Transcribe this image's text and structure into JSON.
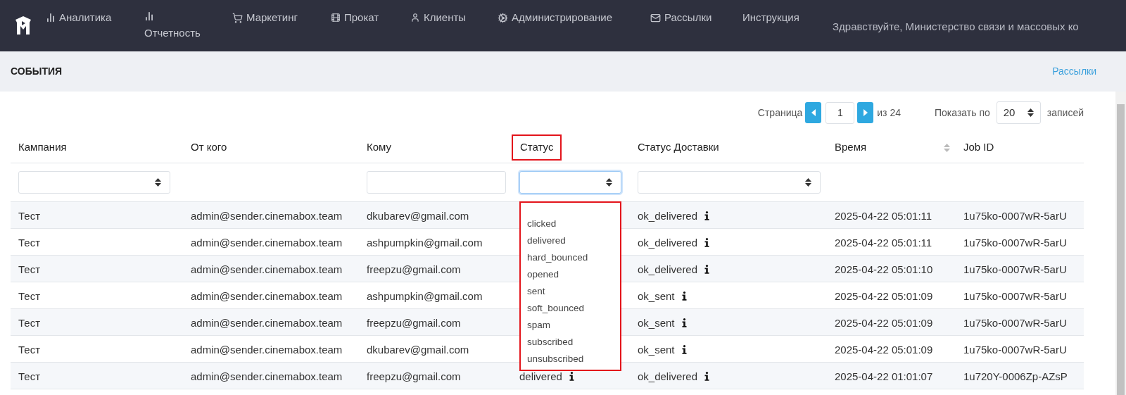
{
  "nav": {
    "items": [
      {
        "label": "Аналитика"
      },
      {
        "label": "Отчетность"
      },
      {
        "label": "Маркетинг"
      },
      {
        "label": "Прокат"
      },
      {
        "label": "Клиенты"
      },
      {
        "label": "Администрирование"
      },
      {
        "label": "Рассылки"
      },
      {
        "label": "Инструкция"
      }
    ],
    "greeting": "Здравствуйте, Министерство связи и массовых ко"
  },
  "page": {
    "title": "СОБЫТИЯ",
    "link": "Рассылки"
  },
  "pagination": {
    "page_label": "Страница",
    "page": "1",
    "of": "из 24",
    "show_label": "Показать по",
    "per_page": "20",
    "records_label": "записей"
  },
  "table": {
    "columns": [
      {
        "label": "Кампания",
        "highlighted": false,
        "sortable": false
      },
      {
        "label": "От кого",
        "highlighted": false,
        "sortable": false
      },
      {
        "label": "Кому",
        "highlighted": false,
        "sortable": false
      },
      {
        "label": "Статус",
        "highlighted": true,
        "sortable": false
      },
      {
        "label": "Статус Доставки",
        "highlighted": false,
        "sortable": false
      },
      {
        "label": "Время",
        "highlighted": false,
        "sortable": true
      },
      {
        "label": "Job ID",
        "highlighted": false,
        "sortable": false
      }
    ],
    "filters": [
      {
        "kind": "select",
        "focused": false
      },
      {
        "kind": "blank"
      },
      {
        "kind": "input",
        "focused": false
      },
      {
        "kind": "select",
        "focused": true
      },
      {
        "kind": "select",
        "focused": false
      },
      {
        "kind": "blank"
      },
      {
        "kind": "blank"
      }
    ],
    "status_dropdown": {
      "options": [
        "clicked",
        "delivered",
        "hard_bounced",
        "opened",
        "sent",
        "soft_bounced",
        "spam",
        "subscribed",
        "unsubscribed"
      ]
    },
    "rows": [
      {
        "campaign": "Тест",
        "from": "admin@sender.cinemabox.team",
        "to": "dkubarev@gmail.com",
        "delivery": "ok_delivered",
        "time": "2025-04-22 05:01:11",
        "job_id": "1u75ko-0007wR-5arU"
      },
      {
        "campaign": "Тест",
        "from": "admin@sender.cinemabox.team",
        "to": "ashpumpkin@gmail.com",
        "delivery": "ok_delivered",
        "time": "2025-04-22 05:01:11",
        "job_id": "1u75ko-0007wR-5arU"
      },
      {
        "campaign": "Тест",
        "from": "admin@sender.cinemabox.team",
        "to": "freepzu@gmail.com",
        "delivery": "ok_delivered",
        "time": "2025-04-22 05:01:10",
        "job_id": "1u75ko-0007wR-5arU"
      },
      {
        "campaign": "Тест",
        "from": "admin@sender.cinemabox.team",
        "to": "ashpumpkin@gmail.com",
        "delivery": "ok_sent",
        "time": "2025-04-22 05:01:09",
        "job_id": "1u75ko-0007wR-5arU"
      },
      {
        "campaign": "Тест",
        "from": "admin@sender.cinemabox.team",
        "to": "freepzu@gmail.com",
        "delivery": "ok_sent",
        "time": "2025-04-22 05:01:09",
        "job_id": "1u75ko-0007wR-5arU"
      },
      {
        "campaign": "Тест",
        "from": "admin@sender.cinemabox.team",
        "to": "dkubarev@gmail.com",
        "delivery": "ok_sent",
        "time": "2025-04-22 05:01:09",
        "job_id": "1u75ko-0007wR-5arU"
      },
      {
        "campaign": "Тест",
        "from": "admin@sender.cinemabox.team",
        "to": "freepzu@gmail.com",
        "status": "delivered",
        "delivery": "ok_delivered",
        "time": "2025-04-22 01:01:07",
        "job_id": "1u720Y-0006Zp-AZsP"
      }
    ]
  }
}
